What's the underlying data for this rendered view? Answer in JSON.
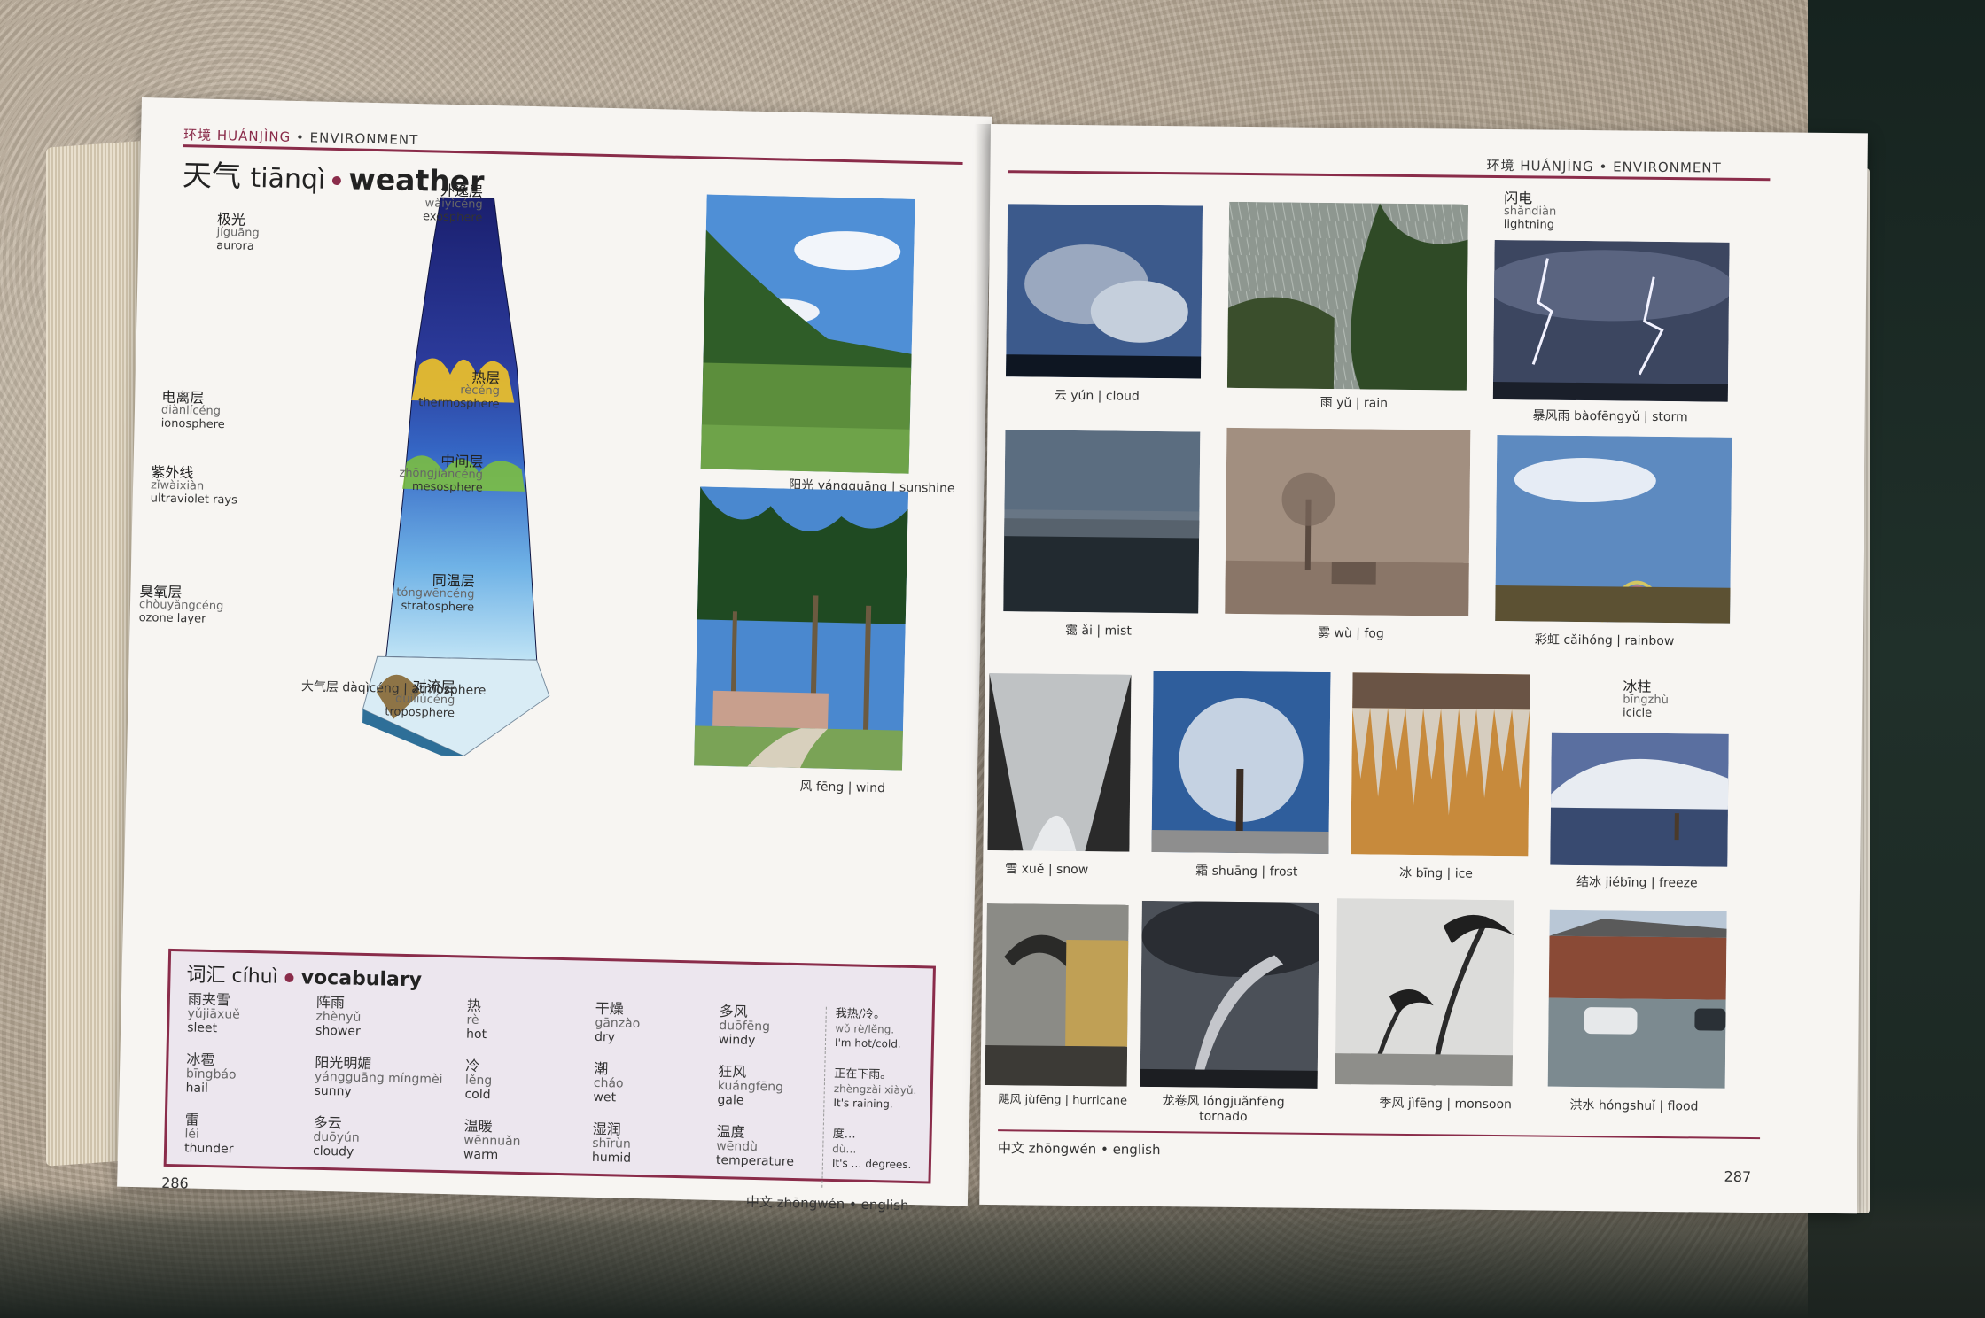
{
  "left_page": {
    "running_head_cn": "环境",
    "running_head_py": "HUÁNJÌNG",
    "running_head_en": "ENVIRONMENT",
    "title_cn": "天气",
    "title_py": "tiānqì",
    "title_en": "weather",
    "labels": {
      "exosphere": {
        "cn": "外逸层",
        "py": "wàiyìcéng",
        "en": "exosphere"
      },
      "aurora": {
        "cn": "极光",
        "py": "jíguāng",
        "en": "aurora"
      },
      "thermosphere": {
        "cn": "热层",
        "py": "rècéng",
        "en": "thermosphere"
      },
      "mesosphere": {
        "cn": "中间层",
        "py": "zhōngjiāncéng",
        "en": "mesosphere"
      },
      "ionosphere": {
        "cn": "电离层",
        "py": "diànlícéng",
        "en": "ionosphere"
      },
      "ultraviolet": {
        "cn": "紫外线",
        "py": "zǐwàixiàn",
        "en": "ultraviolet rays"
      },
      "stratosphere": {
        "cn": "同温层",
        "py": "tóngwēncéng",
        "en": "stratosphere"
      },
      "ozone": {
        "cn": "臭氧层",
        "py": "chòuyǎngcéng",
        "en": "ozone layer"
      },
      "troposphere": {
        "cn": "对流层",
        "py": "duìliúcéng",
        "en": "troposphere"
      }
    },
    "atmosphere_caption": "大气层 dàqìcéng | atmosphere",
    "sunshine_caption": "阳光 yángguāng | sunshine",
    "wind_caption": "风 fēng | wind",
    "vocab_title_cn": "词汇",
    "vocab_title_py": "cíhuì",
    "vocab_title_en": "vocabulary",
    "vocab_columns": [
      [
        {
          "cn": "雨夹雪",
          "py": "yǔjiāxuě",
          "en": "sleet"
        },
        {
          "cn": "冰雹",
          "py": "bīngbáo",
          "en": "hail"
        },
        {
          "cn": "雷",
          "py": "léi",
          "en": "thunder"
        }
      ],
      [
        {
          "cn": "阵雨",
          "py": "zhènyǔ",
          "en": "shower"
        },
        {
          "cn": "阳光明媚",
          "py": "yángguāng míngmèi",
          "en": "sunny"
        },
        {
          "cn": "多云",
          "py": "duōyún",
          "en": "cloudy"
        }
      ],
      [
        {
          "cn": "热",
          "py": "rè",
          "en": "hot"
        },
        {
          "cn": "冷",
          "py": "lěng",
          "en": "cold"
        },
        {
          "cn": "温暖",
          "py": "wēnnuǎn",
          "en": "warm"
        }
      ],
      [
        {
          "cn": "干燥",
          "py": "gānzào",
          "en": "dry"
        },
        {
          "cn": "潮",
          "py": "cháo",
          "en": "wet"
        },
        {
          "cn": "湿润",
          "py": "shīrùn",
          "en": "humid"
        }
      ],
      [
        {
          "cn": "多风",
          "py": "duōfēng",
          "en": "windy"
        },
        {
          "cn": "狂风",
          "py": "kuángfēng",
          "en": "gale"
        },
        {
          "cn": "温度",
          "py": "wēndù",
          "en": "temperature"
        }
      ],
      [
        {
          "cn": "我热/冷。",
          "py": "wǒ rè/lěng.",
          "en": "I'm hot/cold."
        },
        {
          "cn": "正在下雨。",
          "py": "zhèngzài xiàyǔ.",
          "en": "It's raining."
        },
        {
          "cn": "度…",
          "py": "dù…",
          "en": "It's … degrees."
        }
      ]
    ],
    "page_number": "286",
    "footer": "中文 zhōngwén • english"
  },
  "right_page": {
    "running_head": "环境 HUÁNJÌNG • ENVIRONMENT",
    "lightning_label": {
      "cn": "闪电",
      "py": "shǎndiàn",
      "en": "lightning"
    },
    "icicle_label": {
      "cn": "冰柱",
      "py": "bīngzhù",
      "en": "icicle"
    },
    "captions": {
      "cloud": "云 yún | cloud",
      "rain": "雨 yǔ | rain",
      "storm": "暴风雨 bàofēngyǔ | storm",
      "mist": "霭 ǎi | mist",
      "fog": "雾 wù | fog",
      "rainbow": "彩虹 cǎihóng | rainbow",
      "snow": "雪 xuě | snow",
      "frost": "霜 shuāng | frost",
      "ice": "冰 bīng | ice",
      "freeze": "结冰 jiébīng | freeze",
      "hurricane": "飓风 jùfēng | hurricane",
      "tornado_line1": "龙卷风 lóngjuǎnfēng",
      "tornado_line2": "tornado",
      "monsoon": "季风 jìfēng | monsoon",
      "flood": "洪水 hóngshuǐ | flood"
    },
    "page_number": "287",
    "footer": "中文 zhōngwén • english"
  },
  "colors": {
    "accent": "#8a2c4a",
    "page": "#f7f5f2",
    "vocab_bg": "#ece6ee"
  }
}
